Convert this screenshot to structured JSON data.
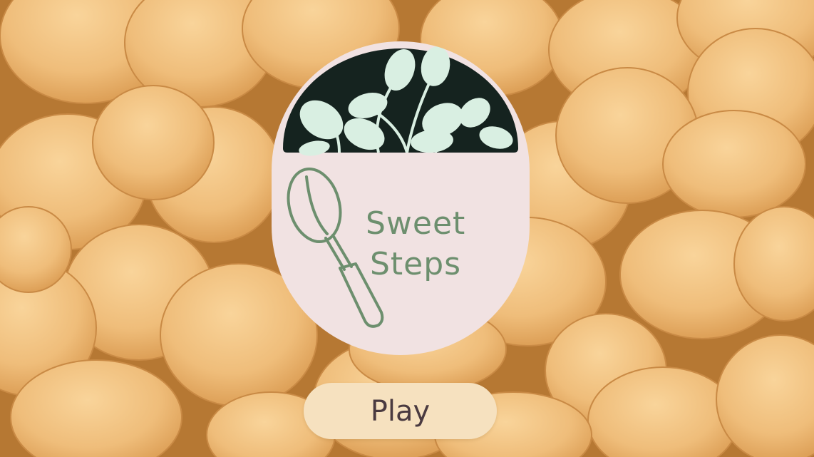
{
  "logo": {
    "title_line1": "Sweet",
    "title_line2": "Steps",
    "icon_mint": "mint-leaves-icon",
    "icon_whisk": "whisk-icon"
  },
  "menu": {
    "play_label": "Play"
  },
  "colors": {
    "badge_background": "#f1e2e2",
    "mint_panel": "#15231f",
    "mint_leaf": "#d9efe2",
    "brand_green": "#6d8f6e",
    "button_background": "#f6e1bf",
    "button_text": "#4a3a40",
    "cookie": "#efbd7a"
  }
}
